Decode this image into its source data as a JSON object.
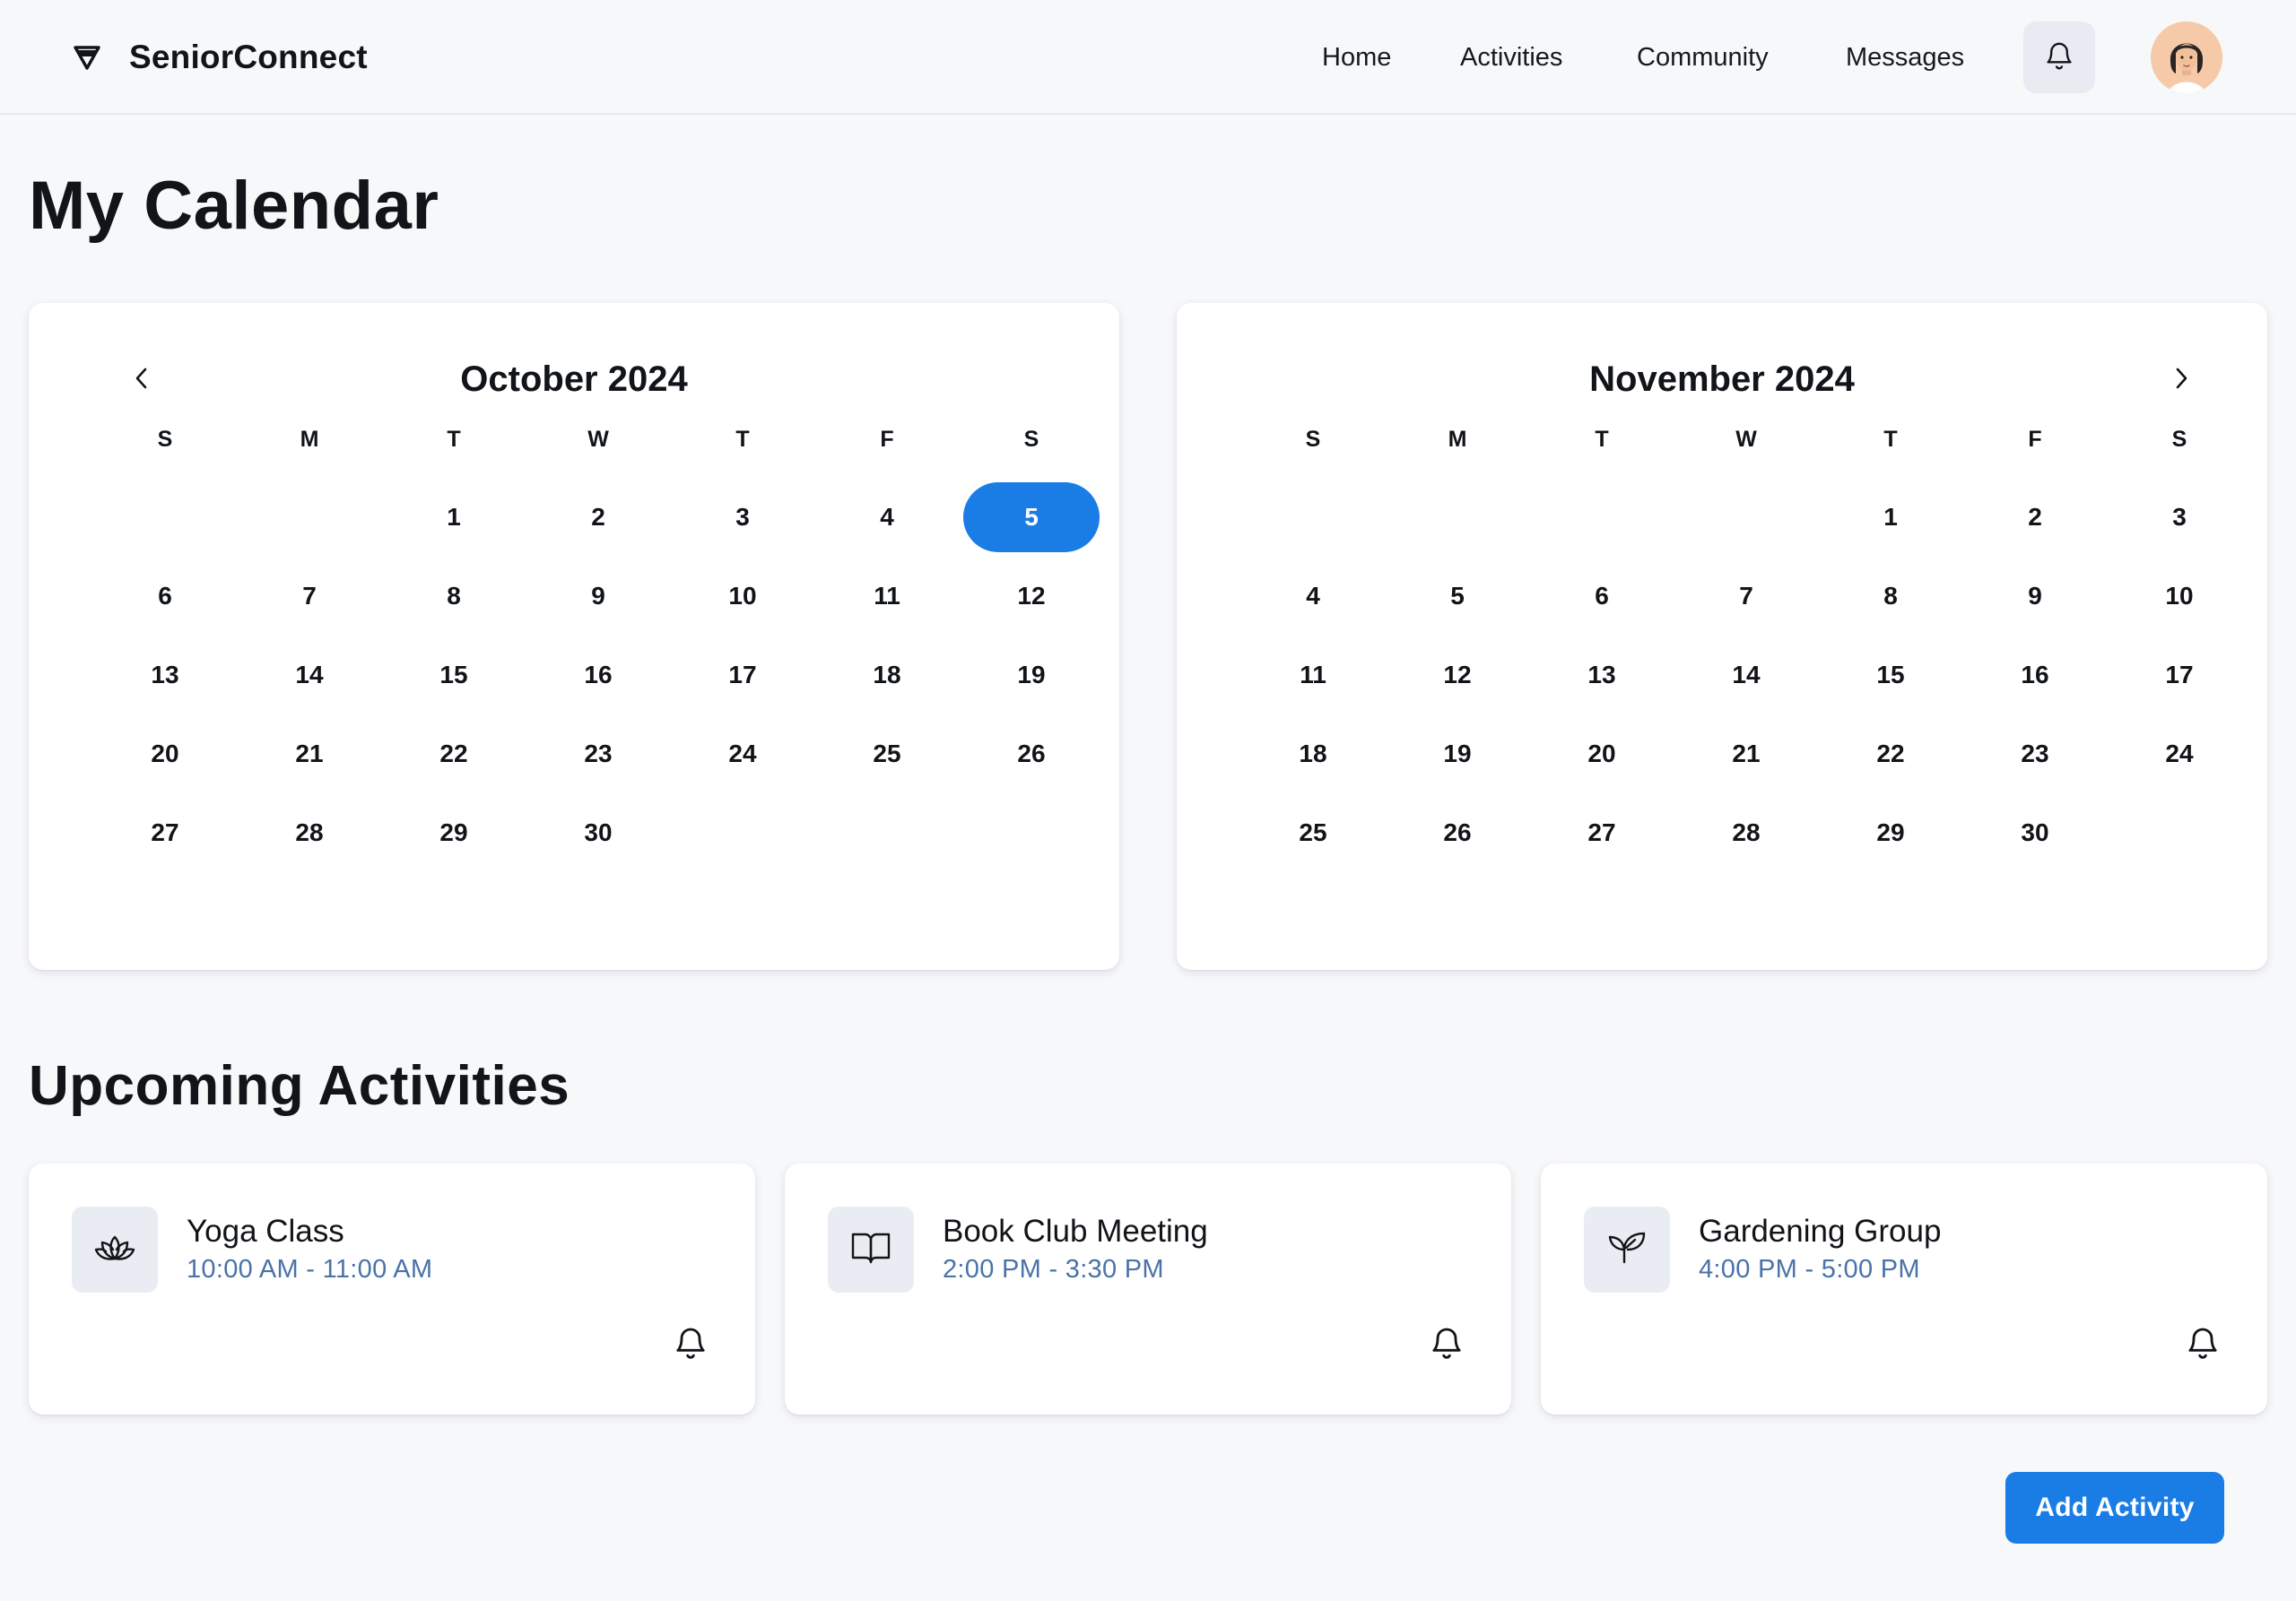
{
  "brand": {
    "name": "SeniorConnect",
    "logo_icon": "shield-logo-icon"
  },
  "nav": {
    "items": [
      {
        "label": "Home"
      },
      {
        "label": "Activities"
      },
      {
        "label": "Community"
      },
      {
        "label": "Messages"
      }
    ],
    "notifications_icon": "bell-icon",
    "avatar": "user-avatar"
  },
  "page": {
    "title": "My Calendar"
  },
  "calendars": [
    {
      "title": "October 2024",
      "weekdays": [
        "S",
        "M",
        "T",
        "W",
        "T",
        "F",
        "S"
      ],
      "first_weekday_index": 2,
      "days_in_month": 30,
      "selected_day": 5,
      "nav_icon": "chevron-left-icon"
    },
    {
      "title": "November 2024",
      "weekdays": [
        "S",
        "M",
        "T",
        "W",
        "T",
        "F",
        "S"
      ],
      "first_weekday_index": 4,
      "days_in_month": 30,
      "selected_day": null,
      "nav_icon": "chevron-right-icon"
    }
  ],
  "upcoming": {
    "title": "Upcoming Activities",
    "items": [
      {
        "name": "Yoga Class",
        "time": "10:00 AM - 11:00 AM",
        "icon": "lotus-icon"
      },
      {
        "name": "Book Club Meeting",
        "time": "2:00 PM - 3:30 PM",
        "icon": "book-icon"
      },
      {
        "name": "Gardening Group",
        "time": "4:00 PM - 5:00 PM",
        "icon": "plant-icon"
      }
    ]
  },
  "actions": {
    "add_label": "Add Activity"
  },
  "colors": {
    "accent": "#1a7de6",
    "time_text": "#4a73a8",
    "icon_bg": "#e9edf3",
    "page_bg": "#f7f8fa"
  }
}
